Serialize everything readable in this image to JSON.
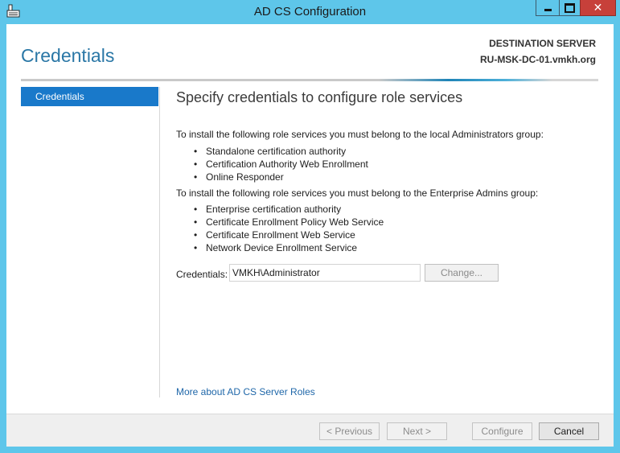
{
  "window": {
    "title": "AD CS Configuration",
    "close_glyph": "✕"
  },
  "header": {
    "title": "Credentials",
    "destination_label": "DESTINATION SERVER",
    "destination_server": "RU-MSK-DC-01.vmkh.org"
  },
  "nav": {
    "items": [
      {
        "label": "Credentials",
        "selected": true
      }
    ]
  },
  "main": {
    "heading": "Specify credentials to configure role services",
    "intro_local": "To install the following role services you must belong to the local Administrators group:",
    "local_services": [
      "Standalone certification authority",
      "Certification Authority Web Enrollment",
      "Online Responder"
    ],
    "intro_enterprise": "To install the following role services you must belong to the Enterprise Admins group:",
    "enterprise_services": [
      "Enterprise certification authority",
      "Certificate Enrollment Policy Web Service",
      "Certificate Enrollment Web Service",
      "Network Device Enrollment Service"
    ],
    "credentials_label": "Credentials:",
    "credentials_value": "VMKH\\Administrator",
    "change_label": "Change...",
    "more_link": "More about AD CS Server Roles"
  },
  "footer": {
    "previous_label": "< Previous",
    "next_label": "Next >",
    "configure_label": "Configure",
    "cancel_label": "Cancel"
  },
  "colors": {
    "frame": "#5ec6ea",
    "accent": "#2a77a6",
    "nav_selected": "#1979ca",
    "link": "#1f67a9",
    "close_button": "#c7403a"
  }
}
